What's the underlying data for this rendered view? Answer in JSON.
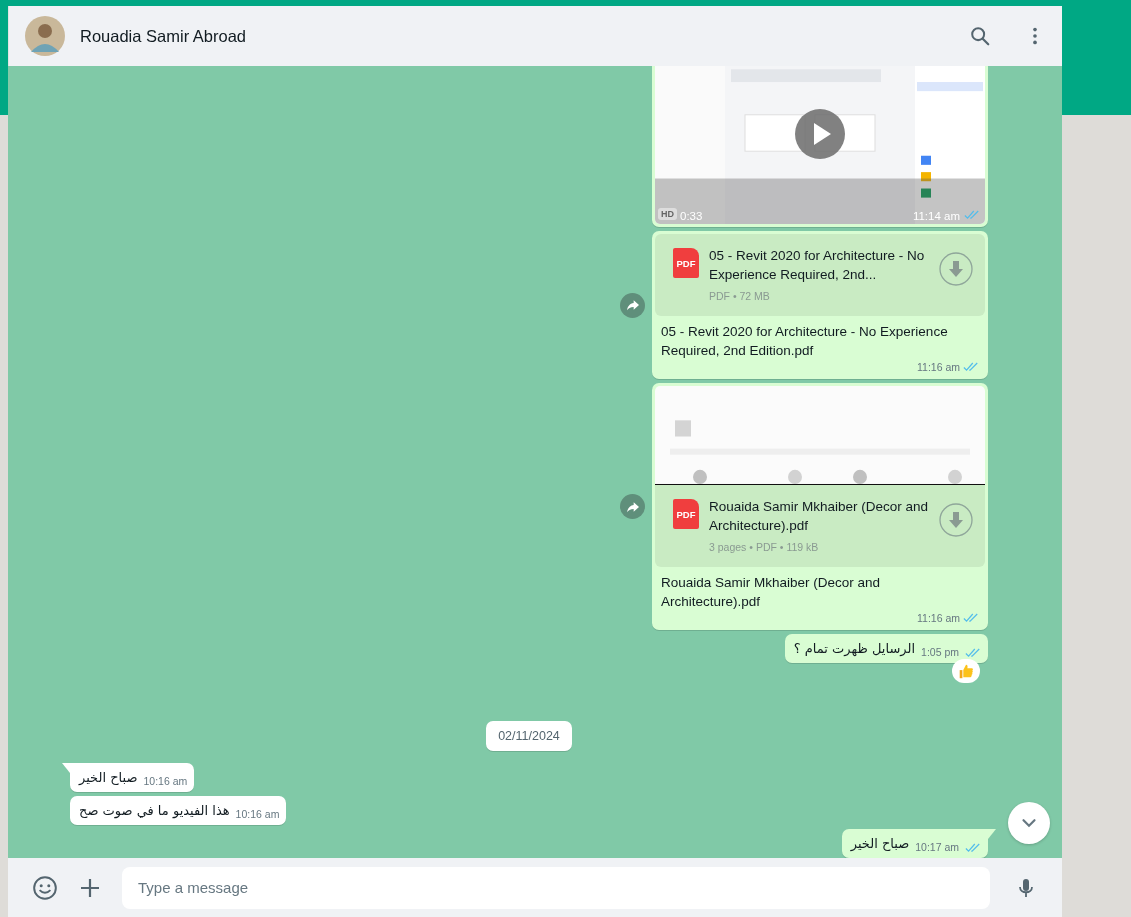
{
  "header": {
    "contact_name": "Rouadia Samir Abroad"
  },
  "messages": [
    {
      "kind": "video",
      "outgoing": true,
      "quality": "HD",
      "duration": "0:33",
      "time": "11:14 am",
      "read": true
    },
    {
      "kind": "document",
      "outgoing": true,
      "forward": true,
      "preview": false,
      "file_type": "PDF",
      "file_title": "05 - Revit 2020 for Architecture - No Experience Required, 2nd...",
      "meta": "PDF • 72 MB",
      "caption": "05 - Revit 2020 for Architecture - No Experience Required, 2nd Edition.pdf",
      "time": "11:16 am",
      "read": true
    },
    {
      "kind": "document",
      "outgoing": true,
      "forward": true,
      "preview": true,
      "file_type": "PDF",
      "file_title": "Rouaida Samir Mkhaiber (Decor and Architecture).pdf",
      "meta": "3 pages • PDF • 119 kB",
      "caption": "Rouaida Samir Mkhaiber (Decor and Architecture).pdf",
      "time": "11:16 am",
      "read": true
    },
    {
      "kind": "text",
      "outgoing": true,
      "tail": false,
      "text": "الرسايل ظهرت تمام ؟",
      "time": "1:05 pm",
      "read": true,
      "reacted": true
    },
    {
      "kind": "date",
      "text": "02/11/2024"
    },
    {
      "kind": "text",
      "outgoing": false,
      "tail": true,
      "text": "صباح الخير",
      "time": "10:16 am"
    },
    {
      "kind": "text",
      "outgoing": false,
      "tail": false,
      "text": "هذا الفيديو ما في صوت صح",
      "time": "10:16 am"
    },
    {
      "kind": "text",
      "outgoing": true,
      "tail": true,
      "text": "صباح الخير",
      "time": "10:17 am",
      "read": true
    }
  ],
  "composer": {
    "placeholder": "Type a message"
  }
}
